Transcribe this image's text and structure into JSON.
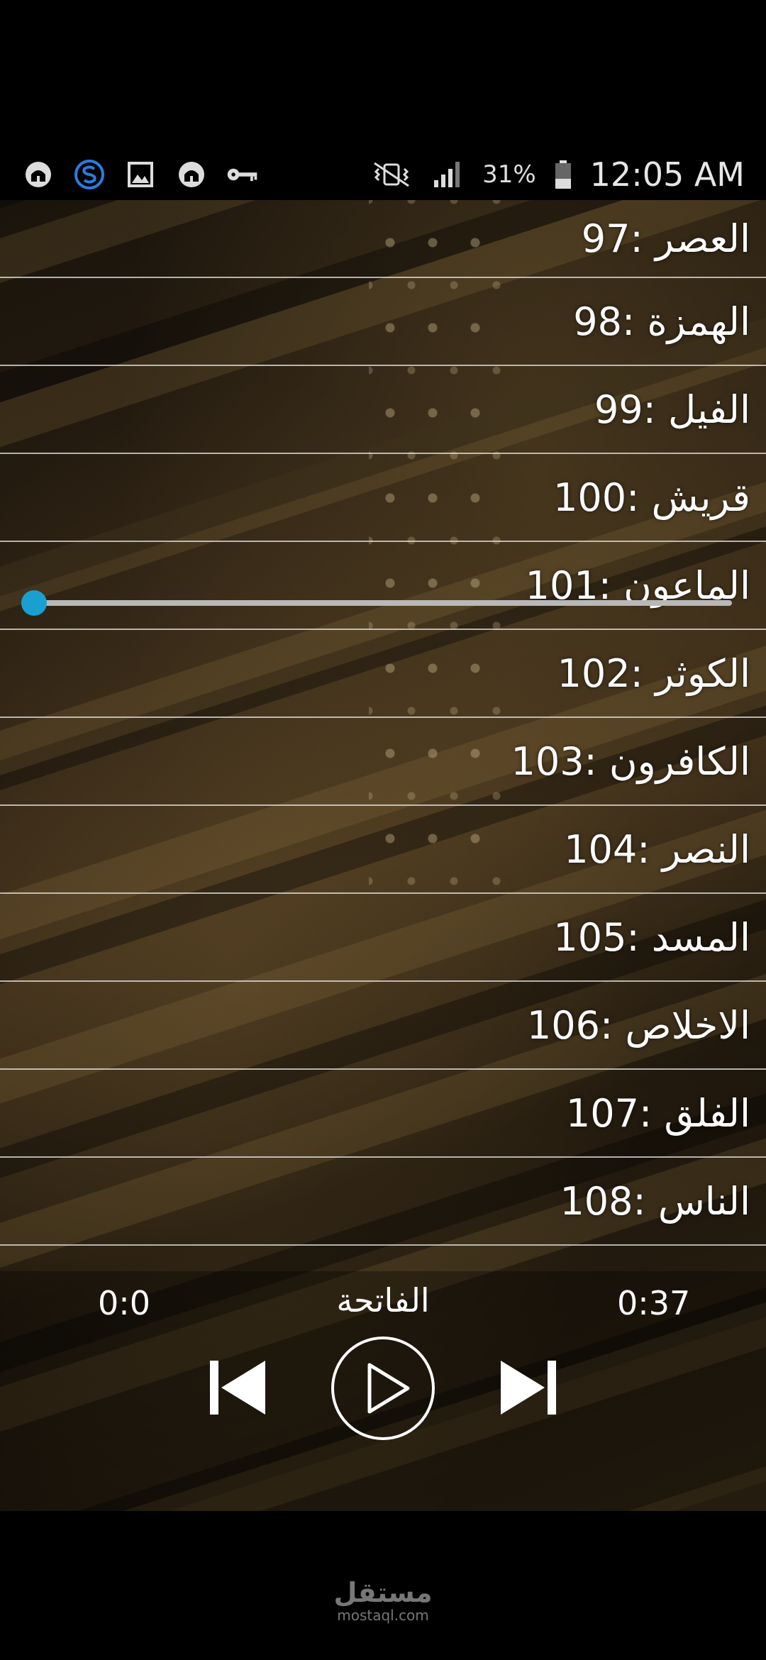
{
  "status_bar": {
    "left_icons": [
      "mosque-icon",
      "s-app-icon",
      "gallery-icon",
      "mosque-icon",
      "key-icon"
    ],
    "battery_percent": "31%",
    "time": "12:05 AM"
  },
  "surah_list": [
    {
      "label": "97: العصر"
    },
    {
      "label": "98: الهمزة"
    },
    {
      "label": "99: الفيل"
    },
    {
      "label": "100: قريش"
    },
    {
      "label": "101: الماعون"
    },
    {
      "label": "102: الكوثر"
    },
    {
      "label": "103: الكافرون"
    },
    {
      "label": "104: النصر"
    },
    {
      "label": "105: المسد"
    },
    {
      "label": "106: الاخلاص"
    },
    {
      "label": "107: الفلق"
    },
    {
      "label": "108: الناس"
    }
  ],
  "player": {
    "current_time": "0:0",
    "track_title": "الفاتحة",
    "duration": "0:37",
    "progress": 0.0,
    "accent_color": "#22a8d8"
  },
  "watermark": {
    "arabic": "مستقل",
    "latin": "mostaql.com"
  }
}
